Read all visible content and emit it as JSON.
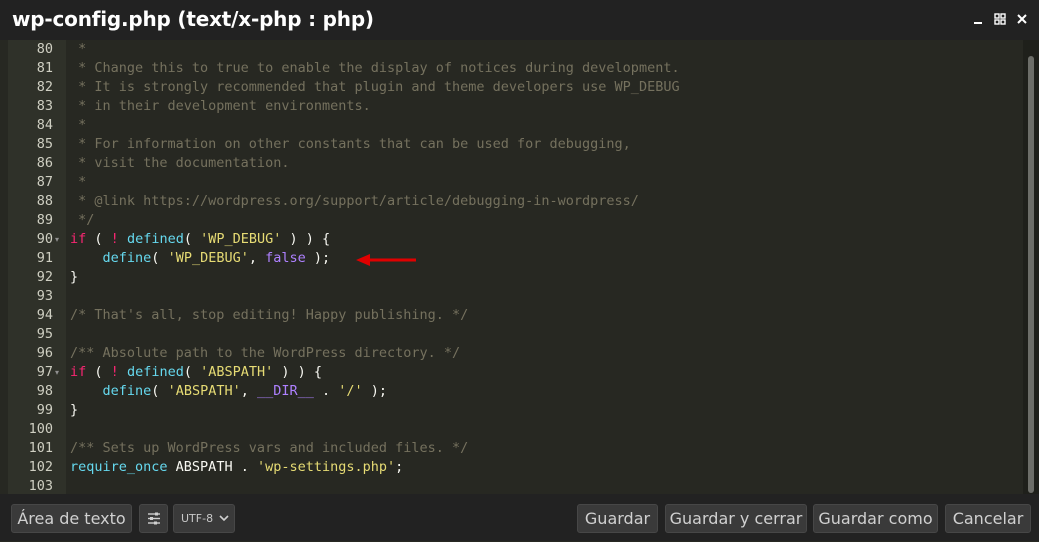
{
  "window": {
    "title": "wp-config.php (text/x-php : php)",
    "controls": [
      "minimize-icon",
      "maximize-icon",
      "close-icon"
    ]
  },
  "editor": {
    "lines": [
      {
        "n": "80",
        "tokens": [
          {
            "t": " *",
            "c": "cm"
          }
        ]
      },
      {
        "n": "81",
        "tokens": [
          {
            "t": " * Change this to true to enable the display of notices during development.",
            "c": "cm"
          }
        ]
      },
      {
        "n": "82",
        "tokens": [
          {
            "t": " * It is strongly recommended that plugin and theme developers use WP_DEBUG",
            "c": "cm"
          }
        ]
      },
      {
        "n": "83",
        "tokens": [
          {
            "t": " * in their development environments.",
            "c": "cm"
          }
        ]
      },
      {
        "n": "84",
        "tokens": [
          {
            "t": " *",
            "c": "cm"
          }
        ]
      },
      {
        "n": "85",
        "tokens": [
          {
            "t": " * For information on other constants that can be used for debugging,",
            "c": "cm"
          }
        ]
      },
      {
        "n": "86",
        "tokens": [
          {
            "t": " * visit the documentation.",
            "c": "cm"
          }
        ]
      },
      {
        "n": "87",
        "tokens": [
          {
            "t": " *",
            "c": "cm"
          }
        ]
      },
      {
        "n": "88",
        "tokens": [
          {
            "t": " * @link https://wordpress.org/support/article/debugging-in-wordpress/",
            "c": "cm"
          }
        ]
      },
      {
        "n": "89",
        "tokens": [
          {
            "t": " */",
            "c": "cm"
          }
        ]
      },
      {
        "n": "90",
        "fold": true,
        "tokens": [
          {
            "t": "if",
            "c": "kw"
          },
          {
            "t": " ( ",
            "c": "plain"
          },
          {
            "t": "!",
            "c": "kw"
          },
          {
            "t": " ",
            "c": "plain"
          },
          {
            "t": "defined",
            "c": "fn"
          },
          {
            "t": "( ",
            "c": "plain"
          },
          {
            "t": "'WP_DEBUG'",
            "c": "str"
          },
          {
            "t": " ) ) {",
            "c": "plain"
          }
        ]
      },
      {
        "n": "91",
        "tokens": [
          {
            "t": "    ",
            "c": "plain"
          },
          {
            "t": "define",
            "c": "fn"
          },
          {
            "t": "( ",
            "c": "plain"
          },
          {
            "t": "'WP_DEBUG'",
            "c": "str"
          },
          {
            "t": ", ",
            "c": "plain"
          },
          {
            "t": "false",
            "c": "cst"
          },
          {
            "t": " );",
            "c": "plain"
          }
        ]
      },
      {
        "n": "92",
        "tokens": [
          {
            "t": "}",
            "c": "plain"
          }
        ]
      },
      {
        "n": "93",
        "tokens": []
      },
      {
        "n": "94",
        "tokens": [
          {
            "t": "/* That's all, stop editing! Happy publishing. */",
            "c": "cm"
          }
        ]
      },
      {
        "n": "95",
        "tokens": []
      },
      {
        "n": "96",
        "tokens": [
          {
            "t": "/** Absolute path to the WordPress directory. */",
            "c": "cm"
          }
        ]
      },
      {
        "n": "97",
        "fold": true,
        "tokens": [
          {
            "t": "if",
            "c": "kw"
          },
          {
            "t": " ( ",
            "c": "plain"
          },
          {
            "t": "!",
            "c": "kw"
          },
          {
            "t": " ",
            "c": "plain"
          },
          {
            "t": "defined",
            "c": "fn"
          },
          {
            "t": "( ",
            "c": "plain"
          },
          {
            "t": "'ABSPATH'",
            "c": "str"
          },
          {
            "t": " ) ) {",
            "c": "plain"
          }
        ]
      },
      {
        "n": "98",
        "tokens": [
          {
            "t": "    ",
            "c": "plain"
          },
          {
            "t": "define",
            "c": "fn"
          },
          {
            "t": "( ",
            "c": "plain"
          },
          {
            "t": "'ABSPATH'",
            "c": "str"
          },
          {
            "t": ", ",
            "c": "plain"
          },
          {
            "t": "__DIR__",
            "c": "cst"
          },
          {
            "t": " . ",
            "c": "plain"
          },
          {
            "t": "'/'",
            "c": "str"
          },
          {
            "t": " );",
            "c": "plain"
          }
        ]
      },
      {
        "n": "99",
        "tokens": [
          {
            "t": "}",
            "c": "plain"
          }
        ]
      },
      {
        "n": "100",
        "tokens": []
      },
      {
        "n": "101",
        "tokens": [
          {
            "t": "/** Sets up WordPress vars and included files. */",
            "c": "cm"
          }
        ]
      },
      {
        "n": "102",
        "tokens": [
          {
            "t": "require_once",
            "c": "fn"
          },
          {
            "t": " ABSPATH . ",
            "c": "plain"
          },
          {
            "t": "'wp-settings.php'",
            "c": "str"
          },
          {
            "t": ";",
            "c": "plain"
          }
        ]
      },
      {
        "n": "103",
        "tokens": []
      }
    ]
  },
  "footer": {
    "text_area_button": "Área de texto",
    "settings_icon": "sliders-icon",
    "encoding": "UTF-8",
    "save_button": "Guardar",
    "save_close_button": "Guardar y cerrar",
    "save_as_button": "Guardar como",
    "cancel_button": "Cancelar"
  },
  "colors": {
    "comment": "#75715e",
    "keyword": "#f92672",
    "function": "#66d9ef",
    "string": "#e6db74",
    "constant": "#ae81ff",
    "annotation_arrow": "#e00000"
  }
}
